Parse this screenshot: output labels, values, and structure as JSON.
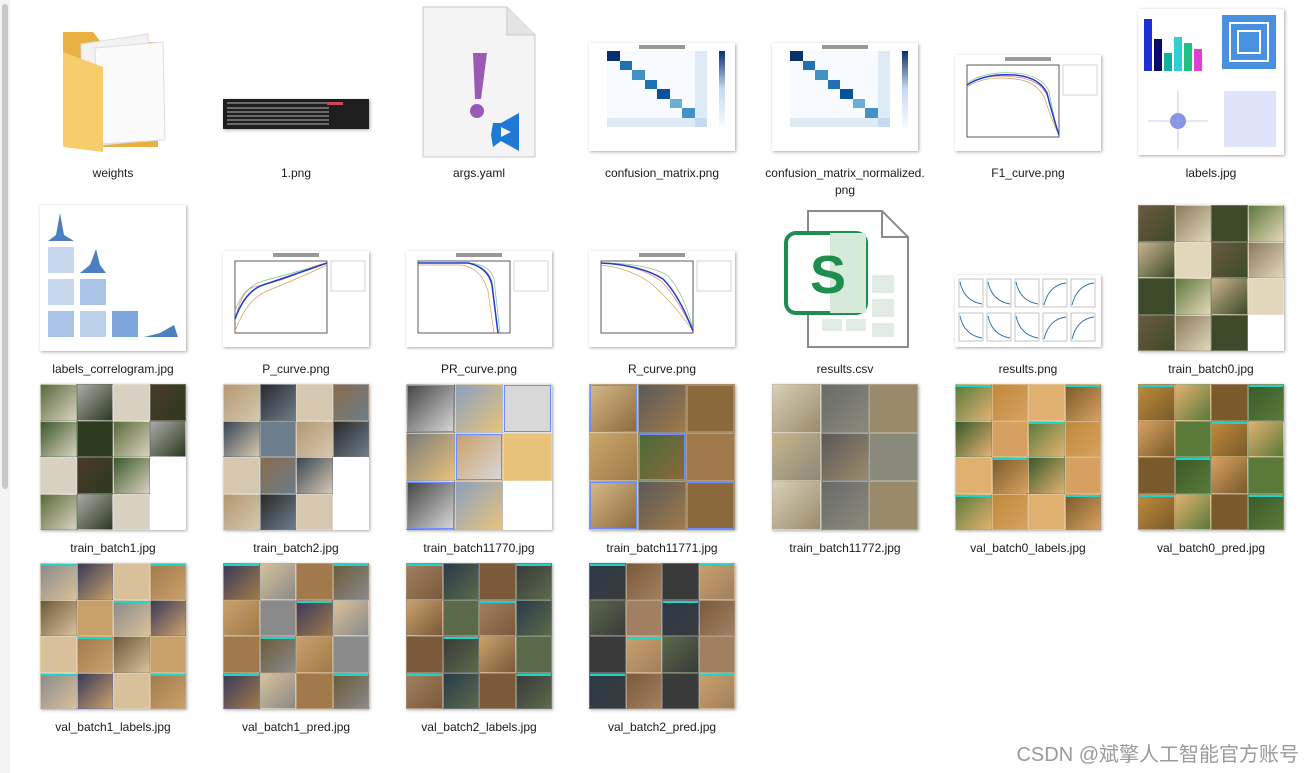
{
  "files": [
    {
      "name": "weights",
      "kind": "folder",
      "icon": "folder-icon"
    },
    {
      "name": "1.png",
      "kind": "terminal-image"
    },
    {
      "name": "args.yaml",
      "kind": "yaml-file",
      "icon": "yaml-file-icon"
    },
    {
      "name": "confusion_matrix.png",
      "kind": "matrix"
    },
    {
      "name": "confusion_matrix_normalized.png",
      "kind": "matrix"
    },
    {
      "name": "F1_curve.png",
      "kind": "curve"
    },
    {
      "name": "labels.jpg",
      "kind": "labels"
    },
    {
      "name": "labels_correlogram.jpg",
      "kind": "correlogram"
    },
    {
      "name": "P_curve.png",
      "kind": "curve"
    },
    {
      "name": "PR_curve.png",
      "kind": "curve"
    },
    {
      "name": "R_curve.png",
      "kind": "curve"
    },
    {
      "name": "results.csv",
      "kind": "spreadsheet",
      "icon": "spreadsheet-file-icon"
    },
    {
      "name": "results.png",
      "kind": "results"
    },
    {
      "name": "train_batch0.jpg",
      "kind": "photos"
    },
    {
      "name": "train_batch1.jpg",
      "kind": "photos"
    },
    {
      "name": "train_batch2.jpg",
      "kind": "photos"
    },
    {
      "name": "train_batch11770.jpg",
      "kind": "photos"
    },
    {
      "name": "train_batch11771.jpg",
      "kind": "photos"
    },
    {
      "name": "train_batch11772.jpg",
      "kind": "photos"
    },
    {
      "name": "val_batch0_labels.jpg",
      "kind": "photos"
    },
    {
      "name": "val_batch0_pred.jpg",
      "kind": "photos"
    },
    {
      "name": "val_batch1_labels.jpg",
      "kind": "photos"
    },
    {
      "name": "val_batch1_pred.jpg",
      "kind": "photos"
    },
    {
      "name": "val_batch2_labels.jpg",
      "kind": "photos"
    },
    {
      "name": "val_batch2_pred.jpg",
      "kind": "photos"
    }
  ],
  "watermark": "CSDN @斌擎人工智能官方账号",
  "colors": {
    "folder": "#f3c35a",
    "yaml_mark": "#9b59b6",
    "vscode": "#1f7ad6",
    "sheet": "#1e8e4e",
    "matrix_dark": "#08306b",
    "curve_blue": "#1f3bd6"
  }
}
